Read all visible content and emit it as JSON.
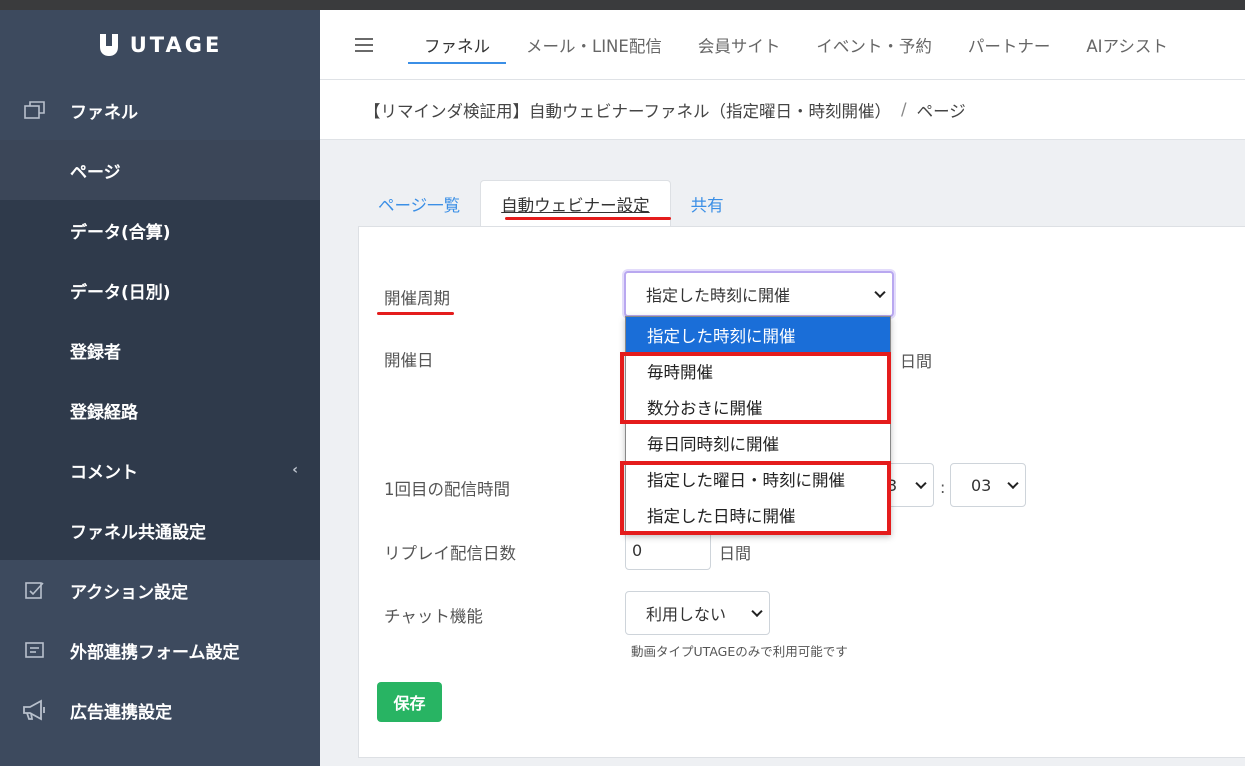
{
  "app": {
    "name": "UTAGE"
  },
  "sidebar": {
    "items": [
      {
        "label": "ファネル",
        "icon": "window-stack-icon"
      },
      {
        "label": "アクション設定",
        "icon": "checkbox-edit-icon"
      },
      {
        "label": "外部連携フォーム設定",
        "icon": "form-icon"
      },
      {
        "label": "広告連携設定",
        "icon": "megaphone-icon"
      }
    ],
    "sub_items": [
      {
        "label": "ページ"
      },
      {
        "label": "データ(合算)"
      },
      {
        "label": "データ(日別)"
      },
      {
        "label": "登録者"
      },
      {
        "label": "登録経路"
      },
      {
        "label": "コメント"
      },
      {
        "label": "ファネル共通設定"
      }
    ]
  },
  "topnav": {
    "tabs": [
      "ファネル",
      "メール・LINE配信",
      "会員サイト",
      "イベント・予約",
      "パートナー",
      "AIアシスト"
    ]
  },
  "breadcrumb": {
    "funnel": "【リマインダ検証用】自動ウェビナーファネル（指定曜日・時刻開催）",
    "separator": "/",
    "current": "ページ"
  },
  "tabs": [
    "ページ一覧",
    "自動ウェビナー設定",
    "共有"
  ],
  "form": {
    "cycle_label": "開催周期",
    "cycle_value": "指定した時刻に開催",
    "date_label": "開催日",
    "date_unit": "日間",
    "first_time_label": "1回目の配信時間",
    "hour_value": "3",
    "time_separator": ":",
    "minute_value": "03",
    "replay_label": "リプレイ配信日数",
    "replay_value": "0",
    "replay_unit": "日間",
    "chat_label": "チャット機能",
    "chat_value": "利用しない",
    "chat_hint": "動画タイプUTAGEのみで利用可能です",
    "save_label": "保存"
  },
  "dropdown": {
    "options": [
      "指定した時刻に開催",
      "毎時開催",
      "数分おきに開催",
      "毎日同時刻に開催",
      "指定した曜日・時刻に開催",
      "指定した日時に開催"
    ]
  },
  "colors": {
    "sidebar": "#3d4a5e",
    "accent": "#3b8fe6",
    "selected_option": "#1a6ed8",
    "save": "#28b463",
    "annotation": "#e41c1c"
  }
}
